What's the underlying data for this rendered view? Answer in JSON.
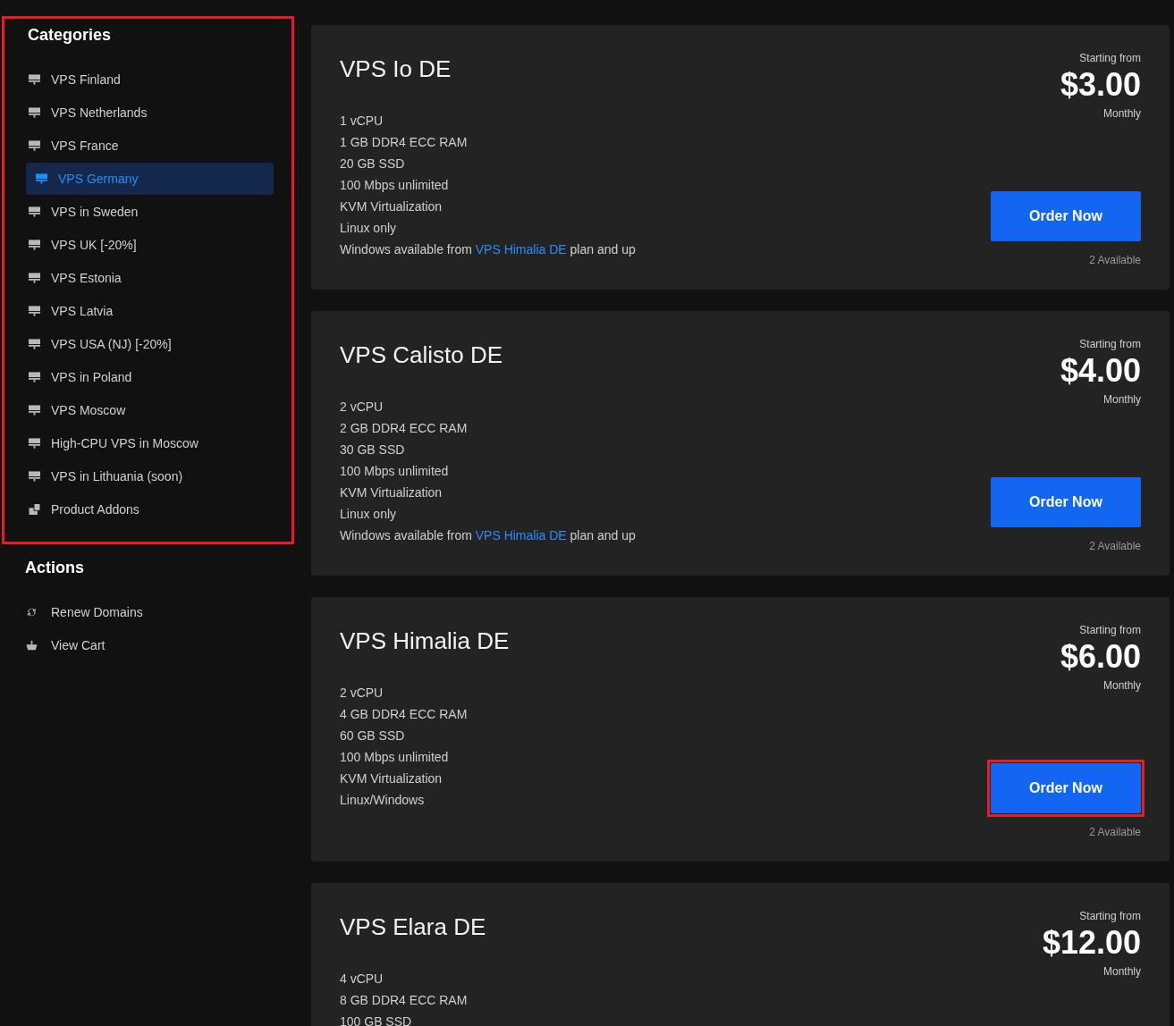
{
  "sidebar": {
    "categories": {
      "title": "Categories",
      "highlighted": true,
      "items": [
        {
          "label": "VPS Finland",
          "kind": "server",
          "selected": false
        },
        {
          "label": "VPS Netherlands",
          "kind": "server",
          "selected": false
        },
        {
          "label": "VPS France",
          "kind": "server",
          "selected": false
        },
        {
          "label": "VPS Germany",
          "kind": "server",
          "selected": true
        },
        {
          "label": "VPS in Sweden",
          "kind": "server",
          "selected": false
        },
        {
          "label": "VPS UK [-20%]",
          "kind": "server",
          "selected": false
        },
        {
          "label": "VPS Estonia",
          "kind": "server",
          "selected": false
        },
        {
          "label": "VPS Latvia",
          "kind": "server",
          "selected": false
        },
        {
          "label": "VPS USA (NJ) [-20%]",
          "kind": "server",
          "selected": false
        },
        {
          "label": "VPS in Poland",
          "kind": "server",
          "selected": false
        },
        {
          "label": "VPS Moscow",
          "kind": "server",
          "selected": false
        },
        {
          "label": "High-CPU VPS in Moscow",
          "kind": "server",
          "selected": false
        },
        {
          "label": "VPS in Lithuania (soon)",
          "kind": "server",
          "selected": false
        },
        {
          "label": "Product Addons",
          "kind": "addons",
          "selected": false
        }
      ]
    },
    "actions": {
      "title": "Actions",
      "items": [
        {
          "label": "Renew Domains",
          "kind": "renew"
        },
        {
          "label": "View Cart",
          "kind": "cart"
        }
      ]
    }
  },
  "products": [
    {
      "name": "VPS Io DE",
      "features": [
        "1 vCPU",
        "1 GB DDR4 ECC RAM",
        "20 GB SSD",
        "100 Mbps unlimited",
        "KVM Virtualization",
        "Linux only"
      ],
      "note": {
        "before": "Windows available from ",
        "link": "VPS Himalia DE",
        "after": " plan and up"
      },
      "price_caption": "Starting from",
      "price": "$3.00",
      "cycle": "Monthly",
      "order_label": "Order Now",
      "highlighted": false,
      "availability": "2 Available"
    },
    {
      "name": "VPS Calisto DE",
      "features": [
        "2 vCPU",
        "2 GB DDR4 ECC RAM",
        "30 GB SSD",
        "100 Mbps unlimited",
        "KVM Virtualization",
        "Linux only"
      ],
      "note": {
        "before": "Windows available from ",
        "link": "VPS Himalia DE",
        "after": " plan and up"
      },
      "price_caption": "Starting from",
      "price": "$4.00",
      "cycle": "Monthly",
      "order_label": "Order Now",
      "highlighted": false,
      "availability": "2 Available"
    },
    {
      "name": "VPS Himalia DE",
      "features": [
        "2 vCPU",
        "4 GB DDR4 ECC RAM",
        "60 GB SSD",
        "100 Mbps unlimited",
        "KVM Virtualization",
        "Linux/Windows"
      ],
      "price_caption": "Starting from",
      "price": "$6.00",
      "cycle": "Monthly",
      "order_label": "Order Now",
      "highlighted": true,
      "availability": "2 Available"
    },
    {
      "name": "VPS Elara DE",
      "features": [
        "4 vCPU",
        "8 GB DDR4 ECC RAM",
        "100 GB SSD"
      ],
      "price_caption": "Starting from",
      "price": "$12.00",
      "cycle": "Monthly"
    }
  ]
}
